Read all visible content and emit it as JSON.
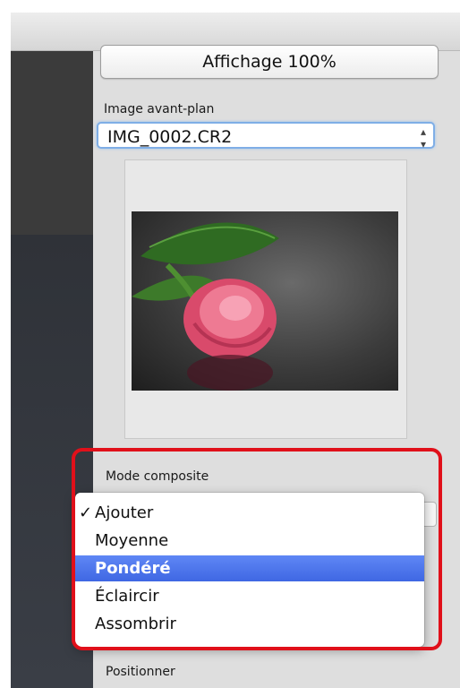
{
  "panel": {
    "zoom_button_label": "Affichage 100%",
    "foreground_label": "Image avant-plan",
    "foreground_value": "IMG_0002.CR2",
    "composite_mode_label": "Mode composite",
    "position_label": "Positionner"
  },
  "composite_menu": {
    "items": [
      {
        "label": "Ajouter",
        "checked": true
      },
      {
        "label": "Moyenne",
        "checked": false
      },
      {
        "label": "Pondéré",
        "checked": false
      },
      {
        "label": "Éclaircir",
        "checked": false
      },
      {
        "label": "Assombrir",
        "checked": false
      }
    ],
    "highlighted": "Pondéré",
    "check_mark": "✓"
  },
  "colors": {
    "highlight": "#3f67e3",
    "annotation_border": "#e0101a"
  }
}
